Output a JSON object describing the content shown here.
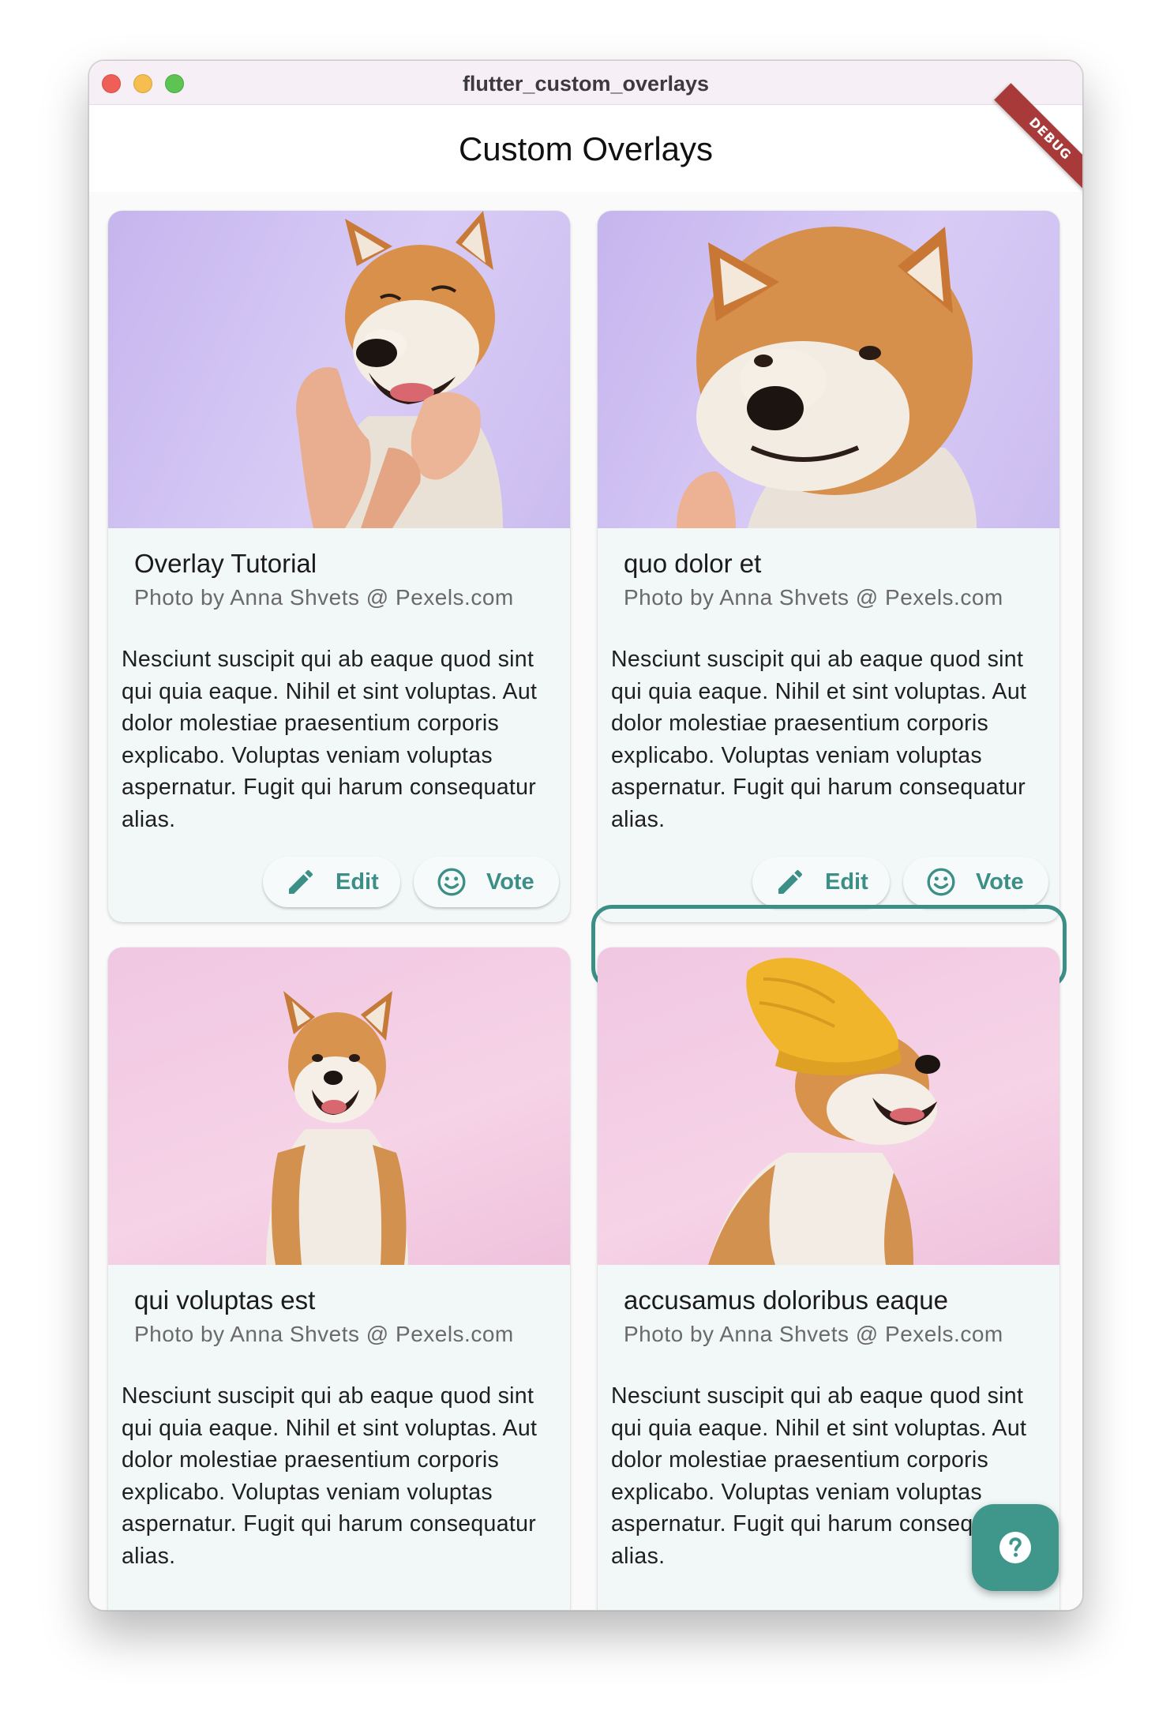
{
  "window": {
    "title": "flutter_custom_overlays"
  },
  "appbar": {
    "title": "Custom Overlays",
    "debug_banner": "DEBUG"
  },
  "cards": [
    {
      "title": "Overlay Tutorial",
      "credit": "Photo by Anna Shvets @ Pexels.com",
      "body": "Nesciunt suscipit qui ab eaque quod sint qui quia eaque. Nihil et sint voluptas. Aut dolor molestiae praesentium corporis explicabo. Voluptas veniam voluptas aspernatur. Fugit qui harum consequatur alias.",
      "edit_label": "Edit",
      "vote_label": "Vote"
    },
    {
      "title": "quo dolor et",
      "credit": "Photo by Anna Shvets @ Pexels.com",
      "body": "Nesciunt suscipit qui ab eaque quod sint qui quia eaque. Nihil et sint voluptas. Aut dolor molestiae praesentium corporis explicabo. Voluptas veniam voluptas aspernatur. Fugit qui harum consequatur alias.",
      "edit_label": "Edit",
      "vote_label": "Vote"
    },
    {
      "title": "qui voluptas est",
      "credit": "Photo by Anna Shvets @ Pexels.com",
      "body": "Nesciunt suscipit qui ab eaque quod sint qui quia eaque. Nihil et sint voluptas. Aut dolor molestiae praesentium corporis explicabo. Voluptas veniam voluptas aspernatur. Fugit qui harum consequatur alias."
    },
    {
      "title": "accusamus doloribus eaque",
      "credit": "Photo by Anna Shvets @ Pexels.com",
      "body": "Nesciunt suscipit qui ab eaque quod sint qui quia eaque. Nihil et sint voluptas. Aut dolor molestiae praesentium corporis explicabo. Voluptas veniam voluptas aspernatur. Fugit qui harum consequatur alias."
    }
  ],
  "fab": {
    "icon": "help-icon"
  },
  "colors": {
    "accent": "#3b8f87",
    "fab": "#3f978c",
    "debug": "#a83a3a",
    "card_bg": "#f2f7f7"
  }
}
